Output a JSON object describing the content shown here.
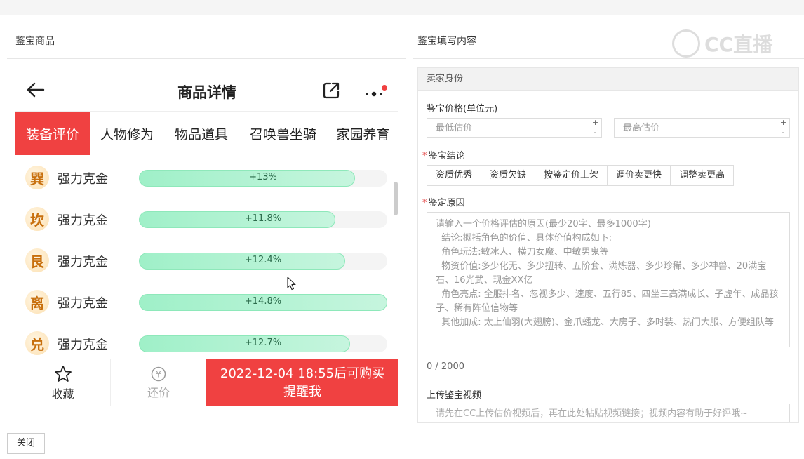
{
  "left_section": {
    "title": "鉴宝商品"
  },
  "right_section": {
    "title": "鉴宝填写内容"
  },
  "watermark": {
    "text": "CC直播"
  },
  "phone": {
    "title": "商品详情",
    "tabs": [
      "装备评价",
      "人物修为",
      "物品道具",
      "召唤兽坐骑",
      "家园养育"
    ],
    "rows": [
      {
        "badge": "巽",
        "label": "强力克金",
        "value": "+13%",
        "fill": 0.87
      },
      {
        "badge": "坎",
        "label": "强力克金",
        "value": "+11.8%",
        "fill": 0.79
      },
      {
        "badge": "艮",
        "label": "强力克金",
        "value": "+12.4%",
        "fill": 0.83
      },
      {
        "badge": "离",
        "label": "强力克金",
        "value": "+14.8%",
        "fill": 1.0
      },
      {
        "badge": "兑",
        "label": "强力克金",
        "value": "+12.7%",
        "fill": 0.85
      }
    ],
    "footer": {
      "favorite": "收藏",
      "bargain": "还价",
      "buy_line1": "2022-12-04 18:55后可购买",
      "buy_line2": "提醒我"
    }
  },
  "form": {
    "section_head": "卖家身份",
    "price_label": "鉴宝价格(单位元)",
    "min_placeholder": "最低估价",
    "max_placeholder": "最高估价",
    "conclusion_label": "鉴宝结论",
    "conclusion_options": [
      "资质优秀",
      "资质欠缺",
      "按鉴定价上架",
      "调价卖更快",
      "调整卖更高"
    ],
    "reason_label": "鉴定原因",
    "reason_placeholder": "请输入一个价格评估的原因(最少20字、最多1000字)\n  结论:概括角色的价值、具体价值构成如下:\n  角色玩法:敏冰人、横刀女魔、中敏男鬼等\n  物资价值:多少化无、多少扭转、五阶套、满炼器、多少珍稀、多少神兽、20满宝石、16光武、现金XX亿\n  角色亮点: 全服排名、忽视多少、速度、五行85、四坐三高满成长、子虚年、成品孩子、稀有阵位信物等\n  其他加成: 太上仙羽(大翅膀)、金爪蟠龙、大房子、多时装、热门大服、方便组队等",
    "char_count": "0 / 2000",
    "video_label": "上传鉴宝视频",
    "video_placeholder": "请先在CC上传估价视频后，再在此处粘贴视频链接；视频内容有助于好评哦~"
  },
  "close_button": "关闭",
  "colors": {
    "accent_red": "#f04141",
    "bar_green": "#9ff0c8",
    "badge_orange": "#c8700e"
  }
}
